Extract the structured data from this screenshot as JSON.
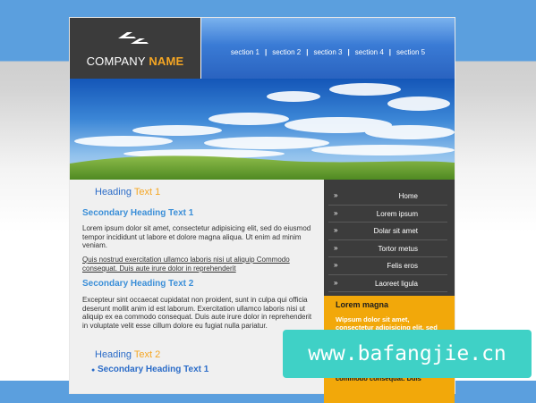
{
  "brand": {
    "name_part1": "COMPANY",
    "name_part2": "NAME"
  },
  "nav": {
    "items": [
      "section 1",
      "section 2",
      "section 3",
      "section 4",
      "section 5"
    ],
    "separator": "|"
  },
  "main": {
    "heading1": {
      "text": "Heading",
      "accent": "Text 1"
    },
    "sec_heading1": "Secondary Heading Text 1",
    "para1": "Lorem ipsum dolor sit amet, consectetur adipisicing elit, sed do eiusmod tempor incididunt ut labore et dolore magna aliqua. Ut enim ad minim veniam.",
    "link_para": "Quis nostrud exercitation ullamco laboris nisi ut aliquip Commodo consequat. Duis aute irure dolor in reprehenderit",
    "sec_heading2": "Secondary Heading Text 2",
    "para2": "Excepteur sint occaecat cupidatat non proident, sunt in culpa qui officia deserunt mollit anim id est laborum. Exercitation ullamco laboris nisi ut aliquip ex ea commodo consequat. Duis aute irure dolor in reprehenderit in voluptate velit esse cillum dolore eu fugiat nulla pariatur.",
    "heading2": {
      "text": "Heading",
      "accent": "Text 2"
    },
    "bullet_symbol": "●",
    "bullet_item": "Secondary Heading Text 1"
  },
  "sidebar": {
    "chevron": "»",
    "menu": [
      "Home",
      "Lorem ipsum",
      "Dolar sit amet",
      "Tortor metus",
      "Felis eros",
      "Laoreet ligula"
    ],
    "promo": {
      "title": "Lorem magna",
      "text": "Wipsum dolor sit amet, consectetur adipisicing elit, sed",
      "text_bottom": "commodo consequat. Duis"
    }
  },
  "watermark": "www.bafangjie.cn",
  "colors": {
    "accent_orange": "#f5a623",
    "link_blue": "#2b6cc8",
    "header_blue": "#3a7bd5",
    "dark_panel": "#3b3b3b"
  }
}
